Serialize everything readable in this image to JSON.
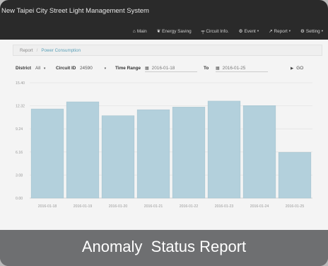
{
  "app": {
    "title": "New Taipei City Street Light Management System"
  },
  "nav": {
    "items": [
      {
        "label": "Main",
        "icon": "home-icon",
        "glyph": "⌂",
        "dropdown": false
      },
      {
        "label": "Energy Saving",
        "icon": "leaf-icon",
        "glyph": "❦",
        "dropdown": false
      },
      {
        "label": "Circuit Info.",
        "icon": "tower-icon",
        "glyph": "╤",
        "dropdown": false
      },
      {
        "label": "Event",
        "icon": "gears-icon",
        "glyph": "⚙",
        "dropdown": true
      },
      {
        "label": "Report",
        "icon": "line-chart-icon",
        "glyph": "↗",
        "dropdown": true
      },
      {
        "label": "Setting",
        "icon": "gears-icon",
        "glyph": "⚙",
        "dropdown": true
      }
    ],
    "caret": "▾"
  },
  "breadcrumb": {
    "parent": "Report",
    "separator": "/",
    "current": "Power Consumption"
  },
  "filters": {
    "district_label": "District",
    "district_value": "All",
    "circuit_label": "Circuit ID",
    "circuit_value": "24590",
    "time_label": "Time Range",
    "from_date": "2016-01-18",
    "to_label": "To",
    "to_date": "2016-01-25",
    "go_label": "GO",
    "caret": "▾",
    "calendar_glyph": "▦",
    "go_glyph": "▶"
  },
  "chart_data": {
    "type": "bar",
    "categories": [
      "2016-01-18",
      "2016-01-19",
      "2016-01-20",
      "2016-01-21",
      "2016-01-22",
      "2016-01-23",
      "2016-01-24",
      "2016-01-25"
    ],
    "values": [
      11.9,
      12.85,
      11.0,
      11.8,
      12.15,
      12.95,
      12.35,
      6.1
    ],
    "yticks": [
      "0.00",
      "3.08",
      "6.16",
      "9.24",
      "12.32",
      "15.40"
    ],
    "ylim": [
      0,
      15.4
    ],
    "bar_color": "#b3d0dc",
    "bar_stroke": "#9fbfcc",
    "grid": true,
    "title": "",
    "xlabel": "",
    "ylabel": ""
  },
  "caption": {
    "text": "Anomaly  Status Report"
  },
  "colors": {
    "navbar": "#2a2a2a",
    "frame": "#6e6f71",
    "accent": "#5aa0b8",
    "background": "#f4f4f4"
  }
}
